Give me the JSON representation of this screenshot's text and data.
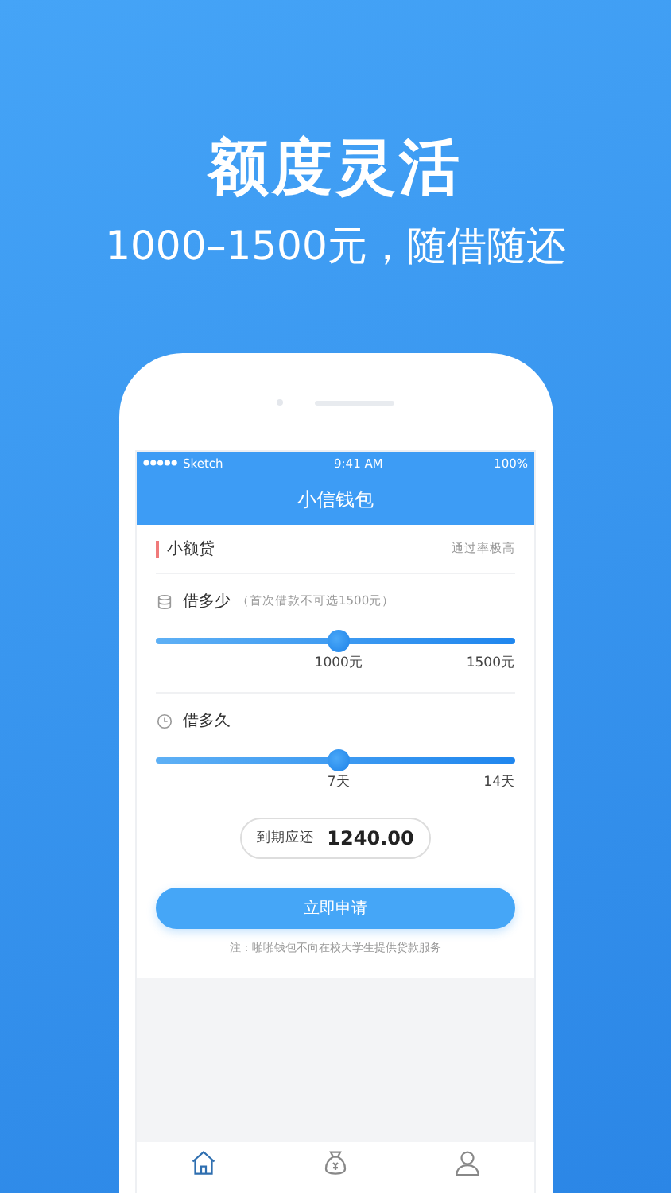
{
  "promo": {
    "title": "额度灵活",
    "subtitle": "1000–1500元，随借随还"
  },
  "status_bar": {
    "carrier": "Sketch",
    "time": "9:41 AM",
    "battery": "100%"
  },
  "nav": {
    "title": "小信钱包"
  },
  "product": {
    "name": "小额贷",
    "note": "通过率极高"
  },
  "amount": {
    "label": "借多少",
    "hint": "（首次借款不可选1500元）",
    "level": 0.51,
    "value": "1000元",
    "max": "1500元"
  },
  "term": {
    "label": "借多久",
    "level": 0.51,
    "value": "7天",
    "max": "14天"
  },
  "due": {
    "label": "到期应还",
    "amount": "1240.00"
  },
  "apply_button": "立即申请",
  "footnote": "注：啪啪钱包不向在校大学生提供贷款服务",
  "tabs": [
    {
      "kind": "home",
      "selected": true
    },
    {
      "kind": "moneybag",
      "selected": false
    },
    {
      "kind": "user",
      "selected": false
    }
  ]
}
